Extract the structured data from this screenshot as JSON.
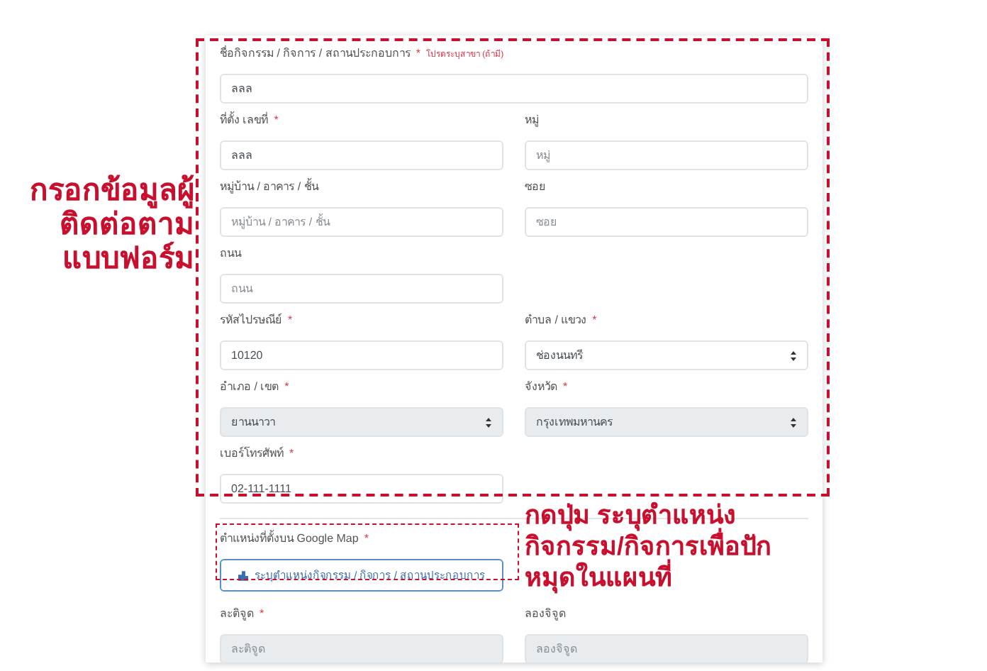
{
  "rows": [
    {
      "fields": [
        {
          "kind": "text",
          "label": "ชื่อกิจกรรม / กิจการ / สถานประกอบการ",
          "mark": "*",
          "hint": "โปรดระบุสาขา (ถ้ามี)",
          "value": "ลลล",
          "disabled": false
        }
      ]
    },
    {
      "fields": [
        {
          "kind": "text",
          "label": "ที่ตั้ง เลขที่",
          "mark": "*",
          "value": "ลลล",
          "disabled": false
        },
        {
          "kind": "text",
          "label": "หมู่",
          "placeholder": "หมู่",
          "disabled": false
        }
      ]
    },
    {
      "fields": [
        {
          "kind": "text",
          "label": "หมู่บ้าน / อาคาร / ชั้น",
          "placeholder": "หมู่บ้าน / อาคาร / ชั้น",
          "disabled": false
        },
        {
          "kind": "text",
          "label": "ซอย",
          "placeholder": "ซอย",
          "disabled": false
        }
      ]
    },
    {
      "fields": [
        {
          "kind": "text",
          "label": "ถนน",
          "placeholder": "ถนน",
          "disabled": false
        }
      ]
    },
    {
      "fields": [
        {
          "kind": "text",
          "label": "รหัสไปรษณีย์",
          "mark": "*",
          "value": "10120",
          "disabled": false
        },
        {
          "kind": "select",
          "label": "ตำบล / แขวง",
          "mark": "*",
          "value": "ช่องนนทรี",
          "disabled": false
        }
      ]
    },
    {
      "fields": [
        {
          "kind": "select",
          "label": "อำเภอ / เขต",
          "mark": "*",
          "value": "ยานนาวา",
          "disabled": true
        },
        {
          "kind": "select",
          "label": "จังหวัด",
          "mark": "*",
          "value": "กรุงเทพมหานคร",
          "disabled": true
        }
      ]
    },
    {
      "fields": [
        {
          "kind": "text",
          "label": "เบอร์โทรศัพท์",
          "mark": "*",
          "value": "02-111-1111",
          "disabled": false
        }
      ]
    }
  ],
  "map": {
    "label": "ตำแหน่งที่ตั้งบน Google Map",
    "mark": "*",
    "button": "ระบุตำแหน่งกิจกรรม / กิจการ / สถานประกอบการ"
  },
  "coords": [
    {
      "kind": "text",
      "label": "ละติจูด",
      "mark": "*",
      "placeholder": "ละติจูด",
      "disabled": true
    },
    {
      "kind": "text",
      "label": "ลองจิจูด",
      "placeholder": "ลองจิจูด",
      "disabled": true
    }
  ],
  "annotations": {
    "form_note": "กรอกข้อมูลผู้ติดต่อตามแบบฟอร์ม",
    "map_note": "กดปุ่ม ระบุตำแหน่งกิจกรรม/กิจการเพื่อปักหมุดในแผนที่"
  }
}
